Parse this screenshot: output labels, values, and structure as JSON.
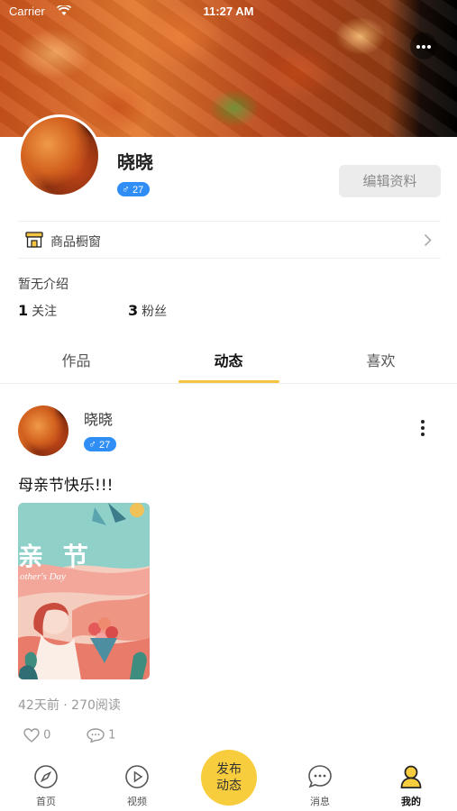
{
  "status_bar": {
    "carrier": "Carrier",
    "time": "11:27 AM"
  },
  "profile": {
    "name": "晓晓",
    "age": "27",
    "gender_symbol": "♂",
    "edit_label": "编辑资料",
    "shop_label": "商品橱窗",
    "intro": "暂无介绍",
    "following_count": "1",
    "following_label": "关注",
    "followers_count": "3",
    "followers_label": "粉丝"
  },
  "tabs": [
    {
      "label": "作品"
    },
    {
      "label": "动态",
      "active": true
    },
    {
      "label": "喜欢"
    }
  ],
  "post": {
    "author": "晓晓",
    "age": "27",
    "gender_symbol": "♂",
    "text": "母亲节快乐!!!",
    "image_caption": "亲 节",
    "image_subcaption": "other's Day",
    "meta": "42天前 · 270阅读",
    "likes": "0",
    "comments": "1"
  },
  "bottom_nav": [
    {
      "label": "首页",
      "icon": "compass-icon"
    },
    {
      "label": "视频",
      "icon": "play-icon"
    },
    {
      "label": "发布动态",
      "line1": "发布",
      "line2": "动态",
      "icon": "publish-button"
    },
    {
      "label": "消息",
      "icon": "chat-icon"
    },
    {
      "label": "我的",
      "icon": "user-icon",
      "active": true
    }
  ],
  "colors": {
    "accent": "#f8cd3d",
    "tab_underline": "#f5c443",
    "badge": "#2f8ef5"
  }
}
